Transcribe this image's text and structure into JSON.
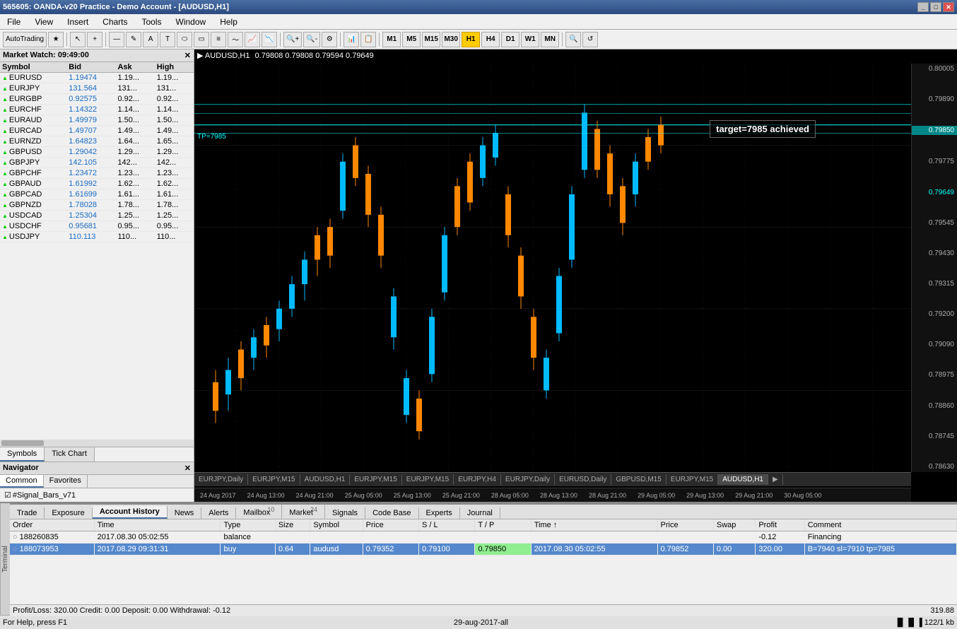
{
  "titleBar": {
    "title": "565605: OANDA-v20 Practice - Demo Account - [AUDUSD,H1]",
    "controls": [
      "minimize",
      "maximize",
      "close"
    ]
  },
  "menuBar": {
    "items": [
      "File",
      "View",
      "Insert",
      "Charts",
      "Tools",
      "Window",
      "Help"
    ]
  },
  "toolbar": {
    "autoTrading": "AutoTrading",
    "timeframes": [
      "M1",
      "M5",
      "M15",
      "M30",
      "H1",
      "H4",
      "D1",
      "W1",
      "MN"
    ],
    "activeTimeframe": "H1"
  },
  "marketWatch": {
    "header": "Market Watch: 09:49:00",
    "columns": [
      "Symbol",
      "Bid",
      "Ask",
      "High"
    ],
    "rows": [
      {
        "symbol": "EURUSD",
        "bid": "1.19474",
        "ask": "1.19...",
        "high": "1.19..."
      },
      {
        "symbol": "EURJPY",
        "bid": "131.564",
        "ask": "131...",
        "high": "131..."
      },
      {
        "symbol": "EURGBP",
        "bid": "0.92575",
        "ask": "0.92...",
        "high": "0.92..."
      },
      {
        "symbol": "EURCHF",
        "bid": "1.14322",
        "ask": "1.14...",
        "high": "1.14..."
      },
      {
        "symbol": "EURAUD",
        "bid": "1.49979",
        "ask": "1.50...",
        "high": "1.50..."
      },
      {
        "symbol": "EURCAD",
        "bid": "1.49707",
        "ask": "1.49...",
        "high": "1.49..."
      },
      {
        "symbol": "EURNZD",
        "bid": "1.64823",
        "ask": "1.64...",
        "high": "1.65..."
      },
      {
        "symbol": "GBPUSD",
        "bid": "1.29042",
        "ask": "1.29...",
        "high": "1.29..."
      },
      {
        "symbol": "GBPJPY",
        "bid": "142.105",
        "ask": "142...",
        "high": "142..."
      },
      {
        "symbol": "GBPCHF",
        "bid": "1.23472",
        "ask": "1.23...",
        "high": "1.23..."
      },
      {
        "symbol": "GBPAUD",
        "bid": "1.61992",
        "ask": "1.62...",
        "high": "1.62..."
      },
      {
        "symbol": "GBPCAD",
        "bid": "1.61699",
        "ask": "1.61...",
        "high": "1.61..."
      },
      {
        "symbol": "GBPNZD",
        "bid": "1.78028",
        "ask": "1.78...",
        "high": "1.78..."
      },
      {
        "symbol": "USDCAD",
        "bid": "1.25304",
        "ask": "1.25...",
        "high": "1.25..."
      },
      {
        "symbol": "USDCHF",
        "bid": "0.95681",
        "ask": "0.95...",
        "high": "0.95..."
      },
      {
        "symbol": "USDJPY",
        "bid": "110.113",
        "ask": "110...",
        "high": "110..."
      }
    ],
    "tabs": [
      "Symbols",
      "Tick Chart"
    ]
  },
  "navigator": {
    "header": "Navigator",
    "tabs": [
      "Common",
      "Favorites"
    ],
    "activeTab": "Common",
    "items": [
      "#Signal_Bars_v71"
    ]
  },
  "chart": {
    "symbol": "AUDUSD,H1",
    "ohlc": "0.79808 0.79808 0.79594 0.79649",
    "targetAnnotation": "target=7985 achieved",
    "tpLabel": "TP=7985",
    "currentPrice": "0.79850",
    "priceScale": [
      "0.80005",
      "0.79890",
      "0.79850",
      "0.79775",
      "0.79649",
      "0.79545",
      "0.79430",
      "0.79315",
      "0.79200",
      "0.79090",
      "0.78975",
      "0.78860",
      "0.78745",
      "0.78630"
    ],
    "timeLabels": [
      "24 Aug 2017",
      "24 Aug 13:00",
      "24 Aug 21:00",
      "25 Aug 05:00",
      "25 Aug 13:00",
      "25 Aug 21:00",
      "28 Aug 05:00",
      "28 Aug 13:00",
      "28 Aug 21:00",
      "29 Aug 05:00",
      "29 Aug 13:00",
      "29 Aug 21:00",
      "30 Aug 05:00"
    ],
    "tabs": [
      "EURJPY,Daily",
      "EURJPY,M15",
      "AUDUSD,H1",
      "EURJPY,M15",
      "EURJPY,M15",
      "EURJPY,H4",
      "EURJPY,Daily",
      "EURUSD,Daily",
      "GBPUSD,M15",
      "EURJPY,M15",
      "AUDUSD,H1"
    ],
    "activeTab": "AUDUSD,H1"
  },
  "bottomPanel": {
    "tabs": [
      "Trade",
      "Exposure",
      "Account History",
      "News",
      "Alerts",
      "Mailbox",
      "Market",
      "Signals",
      "Code Base",
      "Experts",
      "Journal"
    ],
    "activeTab": "Account History",
    "mailboxCount": "10",
    "marketCount": "24",
    "tableHeaders": [
      "Order",
      "Time",
      "Type",
      "Size",
      "Symbol",
      "Price",
      "S / L",
      "T / P",
      "Time",
      "Price",
      "Swap",
      "Profit",
      "Comment"
    ],
    "rows": [
      {
        "order": "188260835",
        "time": "2017.08.30 05:02:55",
        "type": "balance",
        "size": "",
        "symbol": "",
        "price": "",
        "sl": "",
        "tp": "",
        "time2": "",
        "price2": "",
        "swap": "",
        "profit": "-0.12",
        "comment": "Financing"
      },
      {
        "order": "188073953",
        "time": "2017.08.29 09:31:31",
        "type": "buy",
        "size": "0.64",
        "symbol": "audusd",
        "price": "0.79352",
        "sl": "0.79100",
        "tp": "0.79850",
        "time2": "2017.08.30 05:02:55",
        "price2": "0.79852",
        "swap": "0.00",
        "profit": "320.00",
        "comment": "B=7940 sl=7910 tp=7985"
      }
    ],
    "summary": "Profit/Loss: 320.00  Credit: 0.00  Deposit: 0.00  Withdrawal: -0.12",
    "totalProfit": "319.88"
  },
  "statusBar": {
    "helpText": "For Help, press F1",
    "dateFilter": "29-aug-2017-all",
    "memoryInfo": "122/1 kb"
  },
  "sideLabel": "Terminal"
}
